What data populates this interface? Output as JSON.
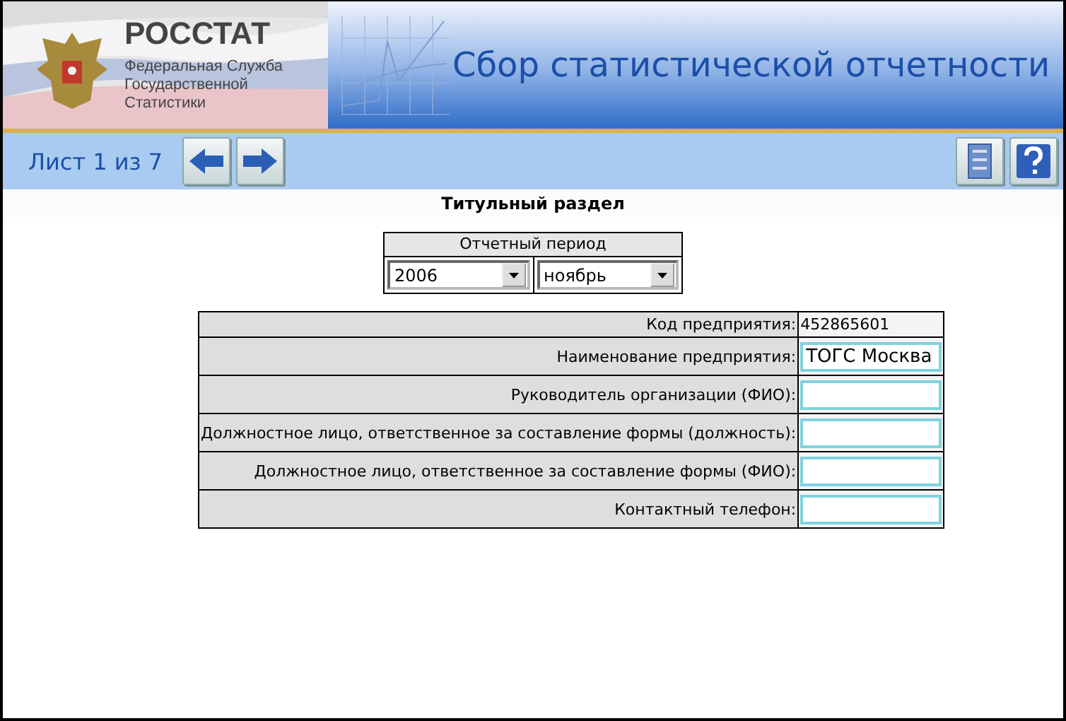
{
  "header": {
    "logo_title": "РОССТАТ",
    "logo_subtitle": "Федеральная Служба Государственной Статистики",
    "title": "Сбор статистической отчетности"
  },
  "nav": {
    "page_label": "Лист 1 из 7"
  },
  "section_title": "Титульный раздел",
  "period": {
    "label": "Отчетный период",
    "selects": [
      {
        "value": "2006"
      },
      {
        "value": "ноябрь"
      }
    ]
  },
  "fields": [
    {
      "label": "Код предприятия:",
      "kind": "text",
      "value": "452865601"
    },
    {
      "label": "Наименование предприятия:",
      "kind": "input",
      "value": "ТОГС Москва"
    },
    {
      "label": "Руководитель организации (ФИО):",
      "kind": "input"
    },
    {
      "label": "Должностное лицо, ответственное за составление формы (должность):",
      "kind": "input"
    },
    {
      "label": "Должностное лицо, ответственное за составление формы (ФИО):",
      "kind": "input"
    },
    {
      "label": "Контактный телефон:",
      "kind": "input"
    }
  ]
}
